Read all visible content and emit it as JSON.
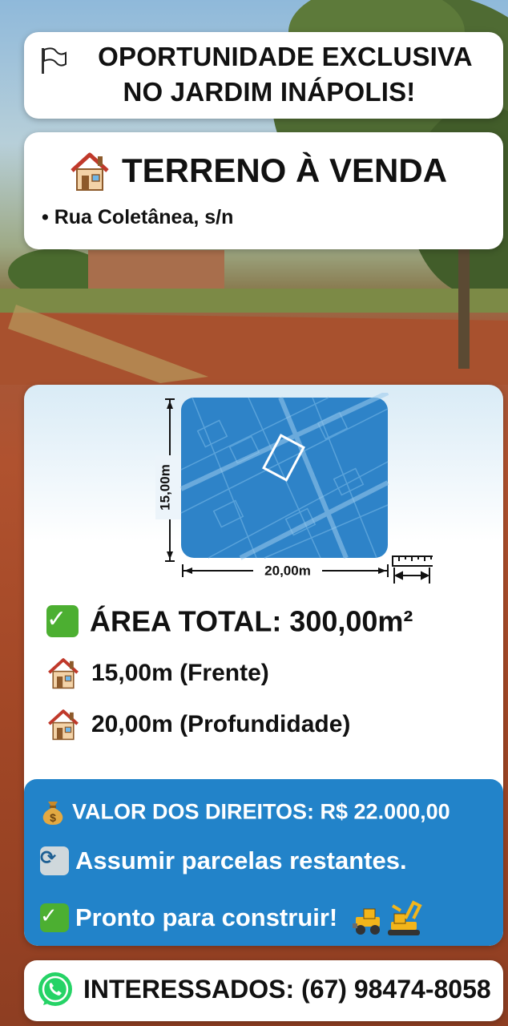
{
  "headline": {
    "line1": "OPORTUNIDADE EXCLUSIVA",
    "line2": "NO JARDIM INÁPOLIS!",
    "icon": "flag-icon"
  },
  "listing": {
    "title": "TERRENO À VENDA",
    "address": "• Rua Coletânea, s/n",
    "icon": "house-icon"
  },
  "plot": {
    "height_label": "15,00m",
    "width_label": "20,00m",
    "map_color": "#2e83c8"
  },
  "stats": {
    "area": "ÁREA TOTAL: 300,00m²",
    "front": "15,00m (Frente)",
    "depth": "20,00m (Profundidade)"
  },
  "pricing": {
    "value": "VALOR DOS DIREITOS: R$ 22.000,00",
    "assume": "Assumir parcelas restantes.",
    "ready": "Pronto para construir!",
    "panel_color": "#2283c9"
  },
  "contact": {
    "text": "INTERESSADOS: (67) 98474-8058",
    "icon": "whatsapp-icon"
  }
}
